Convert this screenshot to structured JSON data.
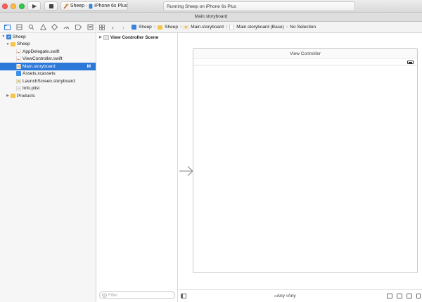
{
  "toolbar": {
    "scheme": "Sheep",
    "device": "iPhone 6s Plus",
    "status": "Running Sheep on iPhone 6s Plus"
  },
  "tab_title": "Main.storyboard",
  "navigator": {
    "items": [
      {
        "label": "Sheep"
      },
      {
        "label": "Sheep"
      },
      {
        "label": "AppDelegate.swift"
      },
      {
        "label": "ViewController.swift"
      },
      {
        "label": "Main.storyboard",
        "badge": "M"
      },
      {
        "label": "Assets.xcassets"
      },
      {
        "label": "LaunchScreen.storyboard"
      },
      {
        "label": "Info.plist"
      },
      {
        "label": "Products"
      }
    ]
  },
  "jumpbar": {
    "crumbs": [
      "Sheep",
      "Sheep",
      "Main.storyboard",
      "Main.storyboard (Base)",
      "No Selection"
    ]
  },
  "outline": {
    "scene": "View Controller Scene",
    "filter_placeholder": "Filter"
  },
  "canvas": {
    "scene_title": "View Controller"
  },
  "bottombar": {
    "width_class": "Any",
    "height_class": "Any"
  },
  "colors": {
    "selection": "#2c78d9",
    "folder": "#f5c547",
    "swift": "#f0663b",
    "close": "#fc605c",
    "minimize": "#fdbc40",
    "maximize": "#34c84a"
  }
}
